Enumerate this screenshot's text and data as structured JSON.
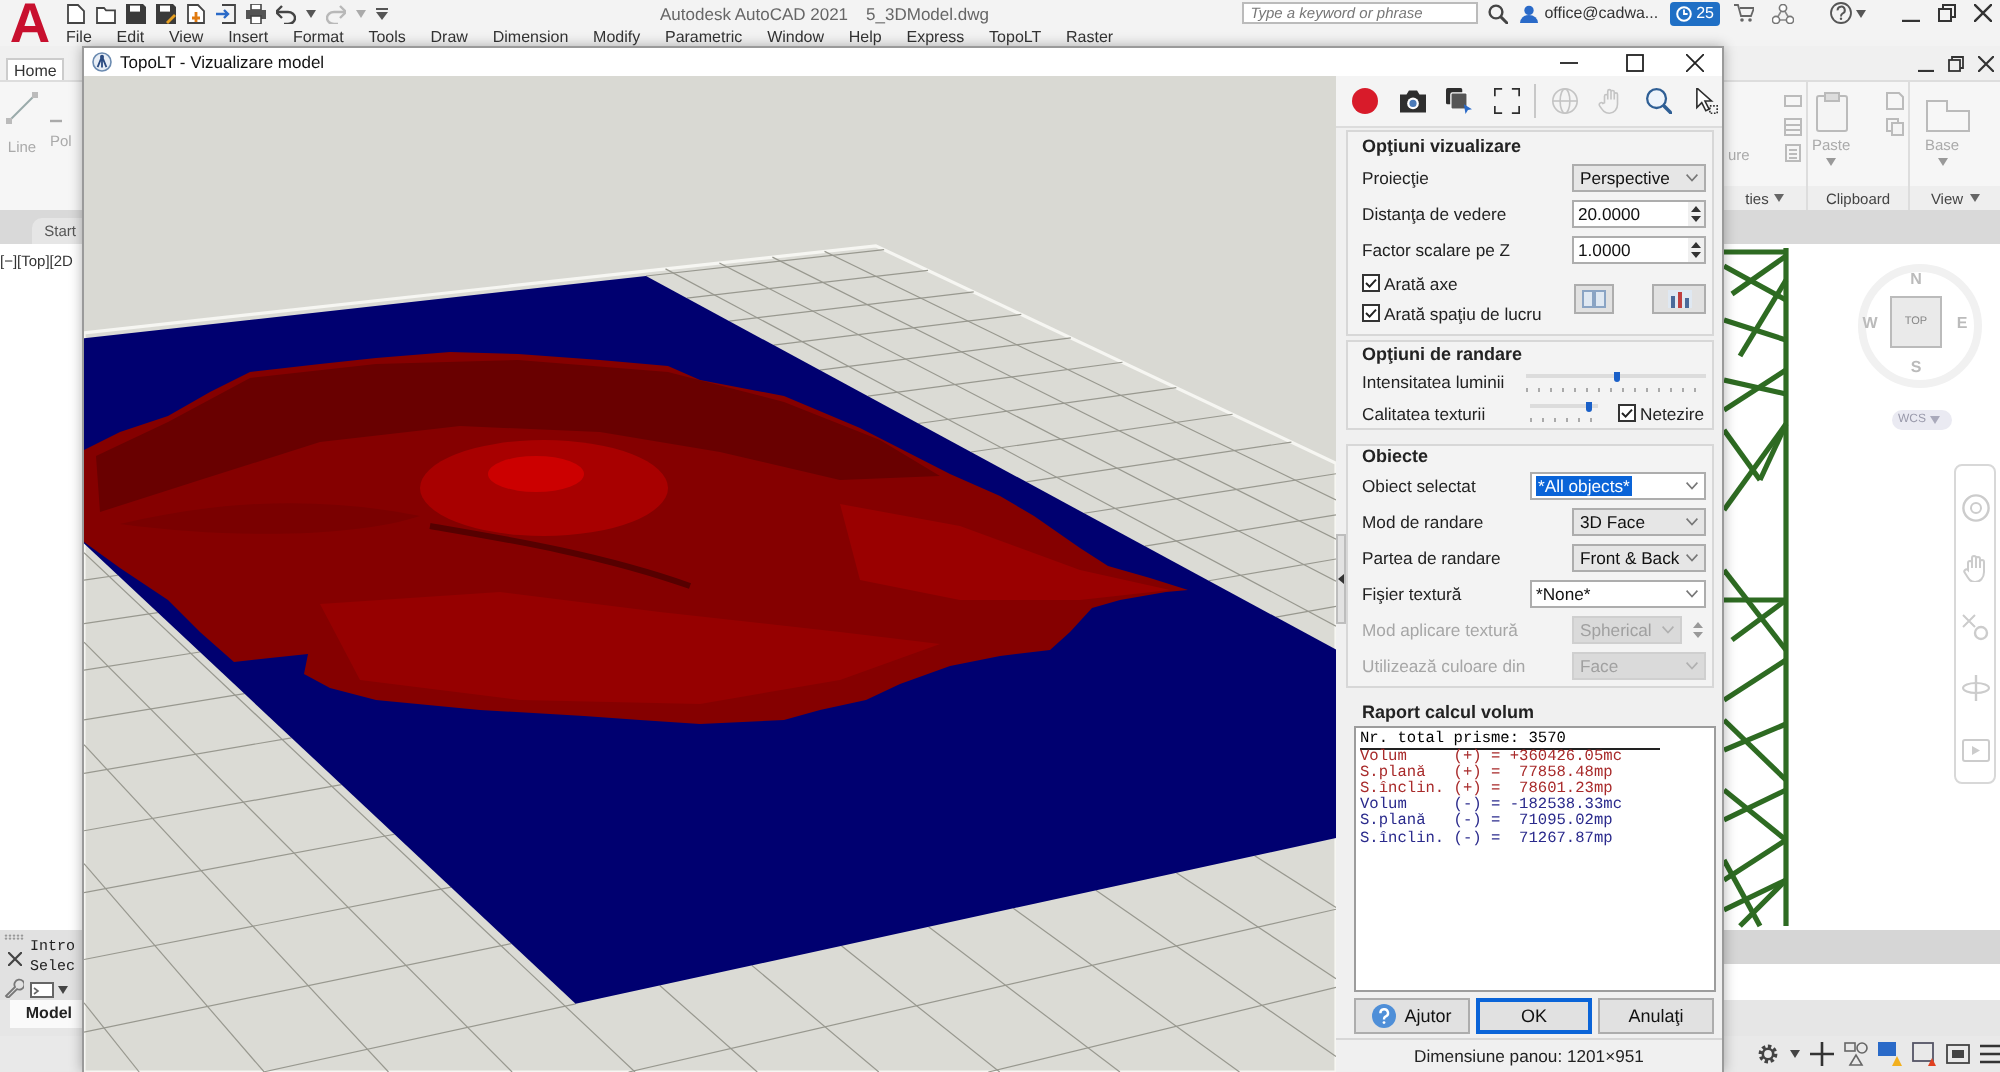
{
  "app": {
    "logo": "A",
    "title": "Autodesk AutoCAD 2021",
    "file": "5_3DModel.dwg",
    "search": {
      "placeholder": "Type a keyword or phrase"
    },
    "user": "office@cadwa...",
    "notifications": "25",
    "menu": [
      "File",
      "Edit",
      "View",
      "Insert",
      "Format",
      "Tools",
      "Draw",
      "Dimension",
      "Modify",
      "Parametric",
      "Window",
      "Help",
      "Express",
      "TopoLT",
      "Raster"
    ],
    "ribbon_tabs": [
      {
        "label": "Home",
        "selected": true
      }
    ],
    "ribbon_left": [
      "Line",
      "Pol"
    ],
    "ribbon_right": {
      "tools": [
        "ure",
        "Paste",
        "Base"
      ],
      "panels": [
        "ties",
        "Clipboard",
        "View"
      ]
    },
    "file_tabs": [
      {
        "label": "Start",
        "selected": false
      }
    ],
    "viewport_label": "[−][Top][2D",
    "viewcube": {
      "north": "N",
      "west": "W",
      "face": "TOP",
      "east": "E",
      "south": "S",
      "coordinate_system": "WCS"
    },
    "command_lines": [
      "Intro",
      "Selec"
    ],
    "layout_tabs": [
      {
        "label": "Model",
        "selected": true
      }
    ]
  },
  "dialog": {
    "title": "TopoLT - Vizualizare model",
    "toolbar": {
      "groups": [
        [
          {
            "kind": "record",
            "disabled": false
          },
          {
            "kind": "camera",
            "disabled": false
          },
          {
            "kind": "layers",
            "disabled": false
          },
          {
            "kind": "fullscreen",
            "disabled": false
          }
        ],
        [
          {
            "kind": "orbit",
            "disabled": true
          },
          {
            "kind": "pan",
            "disabled": true
          },
          {
            "kind": "zoom",
            "disabled": false
          },
          {
            "kind": "pointer",
            "disabled": false
          }
        ]
      ]
    },
    "view_options": {
      "title": "Opţiuni vizualizare",
      "fields": [
        {
          "kind": "dropdown",
          "label": "Proiecţie",
          "value": "Perspective"
        },
        {
          "kind": "spin",
          "label": "Distanţa de vedere",
          "value": "20.0000"
        },
        {
          "kind": "spin",
          "label": "Factor scalare pe Z",
          "value": "1.0000"
        }
      ],
      "checkboxes": [
        {
          "label": "Arată axe",
          "checked": true
        },
        {
          "label": "Arată spaţiu de lucru",
          "checked": true
        }
      ]
    },
    "render_options": {
      "title": "Opţiuni de randare",
      "sliders": [
        {
          "label": "Intensitatea luminii",
          "level": 0.5
        },
        {
          "label": "Calitatea texturii",
          "level": 0.87
        }
      ],
      "smoothing": {
        "label": "Netezire",
        "checked": true
      }
    },
    "objects": {
      "title": "Obiecte",
      "fields": [
        {
          "kind": "combo",
          "label": "Obiect selectat",
          "value": "*All objects*",
          "highlighted": true,
          "disabled": false
        },
        {
          "kind": "dropdown",
          "label": "Mod de randare",
          "value": "3D Face",
          "highlighted": false,
          "disabled": false
        },
        {
          "kind": "dropdown",
          "label": "Partea de randare",
          "value": "Front & Back",
          "highlighted": false,
          "disabled": false
        },
        {
          "kind": "combo",
          "label": "Fişier textură",
          "value": "*None*",
          "highlighted": false,
          "disabled": false
        },
        {
          "kind": "dropdown_spin",
          "label": "Mod aplicare textură",
          "value": "Spherical",
          "highlighted": false,
          "disabled": true
        },
        {
          "kind": "dropdown",
          "label": "Utilizează culoare din",
          "value": "Face",
          "highlighted": false,
          "disabled": true
        }
      ]
    },
    "report": {
      "title": "Raport calcul volum",
      "lines": [
        {
          "kind": "header",
          "text": "Nr. total prisme: 3570",
          "color": "#000000"
        },
        {
          "kind": "value",
          "text": "Volum     (+) = +360426.05mc",
          "color": "#a82a2a"
        },
        {
          "kind": "value",
          "text": "S.plană   (+) =  77858.48mp",
          "color": "#a82a2a"
        },
        {
          "kind": "value",
          "text": "S.înclin. (+) =  78601.23mp",
          "color": "#a82a2a"
        },
        {
          "kind": "value",
          "text": "Volum     (-) = -182538.33mc",
          "color": "#2a2a8c"
        },
        {
          "kind": "value",
          "text": "S.plană   (-) =  71095.02mp",
          "color": "#2a2a8c"
        },
        {
          "kind": "value",
          "text": "S.înclin. (-) =  71267.87mp",
          "color": "#2a2a8c"
        }
      ]
    },
    "buttons": [
      {
        "kind": "help",
        "label": "Ajutor",
        "default": false
      },
      {
        "kind": "plain",
        "label": "OK",
        "default": true
      },
      {
        "kind": "plain",
        "label": "Anulaţi",
        "default": false
      }
    ],
    "status": "Dimensiune panou: 1201×951"
  }
}
